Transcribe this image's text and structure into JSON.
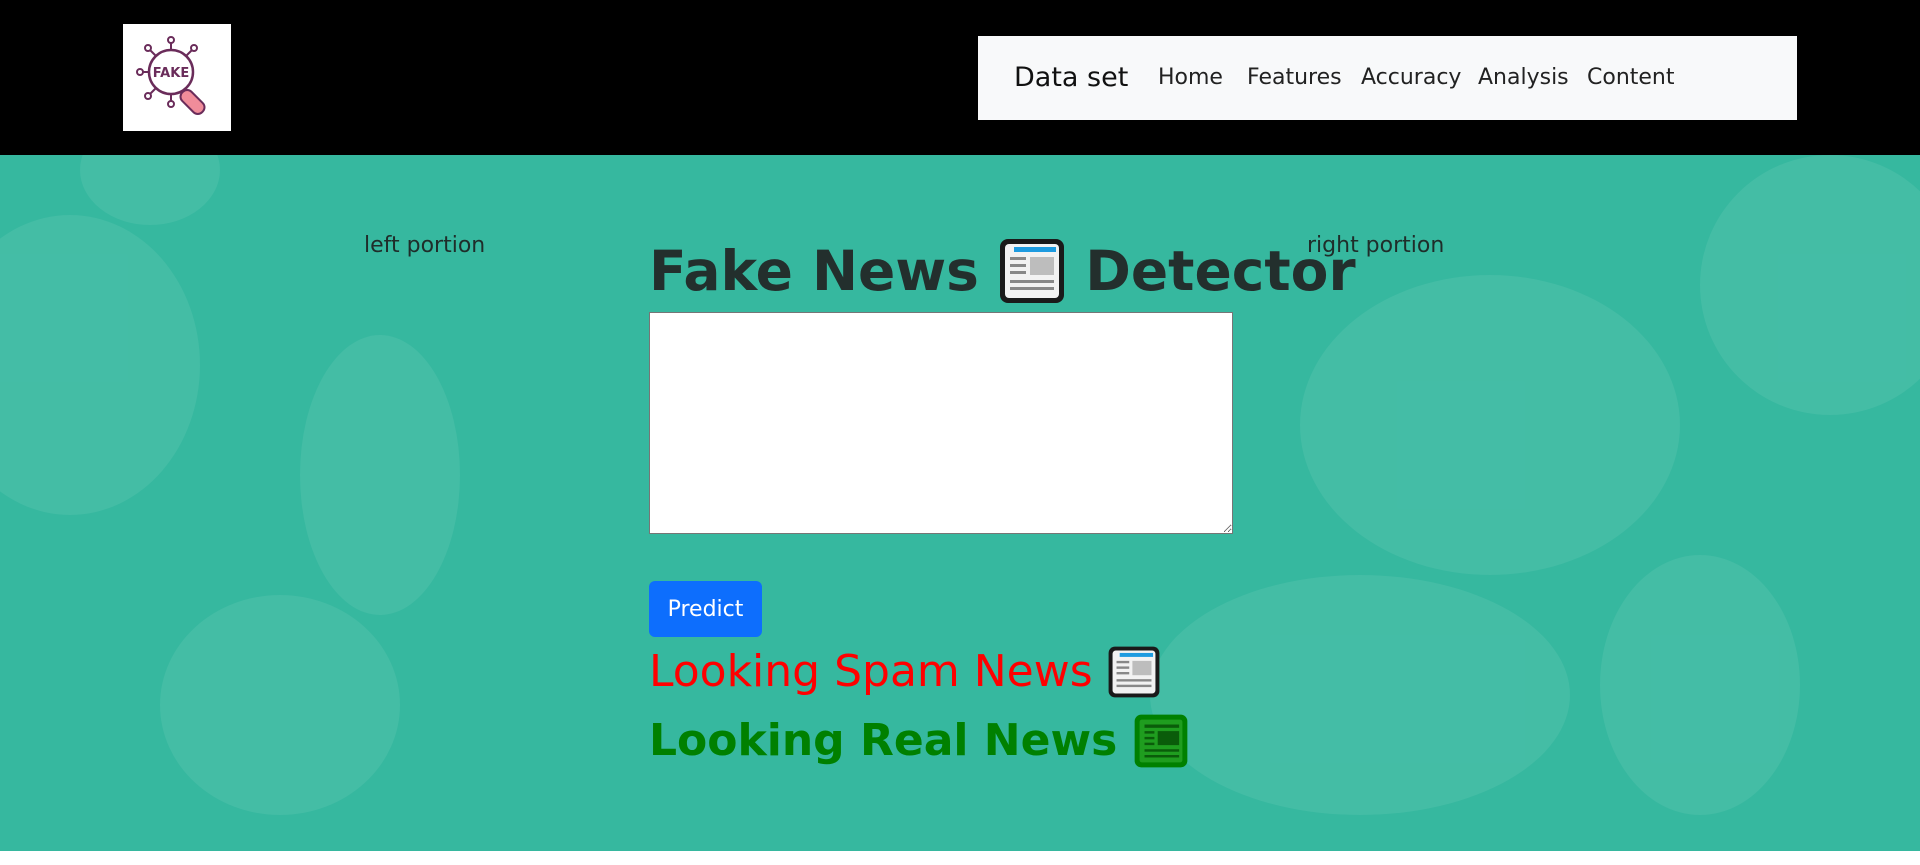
{
  "logo": {
    "text": "FAKE",
    "icon": "fake-magnifier-logo"
  },
  "navbar": {
    "brand": "Data set",
    "links": [
      "Home",
      "Features",
      "Accuracy",
      "Analysis",
      "Content"
    ]
  },
  "hero": {
    "left_label": "left portion",
    "right_label": "right portion",
    "title_part1": "Fake News",
    "title_part2": "Detector",
    "input": {
      "value": "",
      "placeholder": ""
    },
    "predict_label": "Predict",
    "spam_text": "Looking Spam News",
    "real_text": "Looking Real News"
  },
  "colors": {
    "hero_bg": "#36b89f",
    "spam": "#ff0000",
    "real": "#008000",
    "button": "#0d6efd"
  }
}
